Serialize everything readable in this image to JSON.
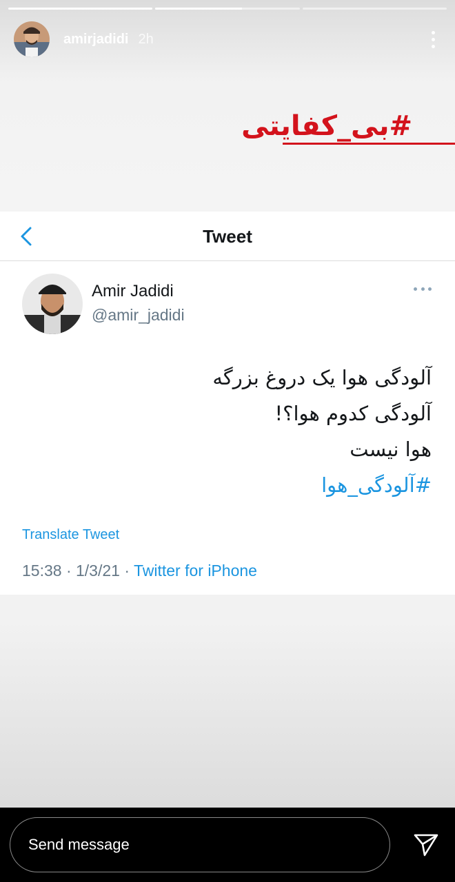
{
  "story": {
    "progress": [
      1.0,
      0.6,
      0.0
    ],
    "username": "amirjadidi",
    "time": "2h",
    "hashtag_sticker": "#بی_کفایتی",
    "hashtag_color": "#d3131c"
  },
  "tweet": {
    "nav_title": "Tweet",
    "author_name": "Amir Jadidi",
    "author_handle": "@amir_jadidi",
    "lines": [
      "آلودگی هوا یک دروغ بزرگه",
      "آلودگی کدوم هوا؟!",
      "هوا نیست"
    ],
    "hashtag": "#آلودگی_هوا",
    "translate_label": "Translate Tweet",
    "timestamp": "15:38 · 1/3/21 · ",
    "source": "Twitter for iPhone",
    "link_color": "#1b95e0"
  },
  "footer": {
    "send_placeholder": "Send message"
  },
  "icons": [
    "story-avatar",
    "more-vertical-icon",
    "back-chevron-icon",
    "more-horizontal-icon",
    "send-icon"
  ]
}
